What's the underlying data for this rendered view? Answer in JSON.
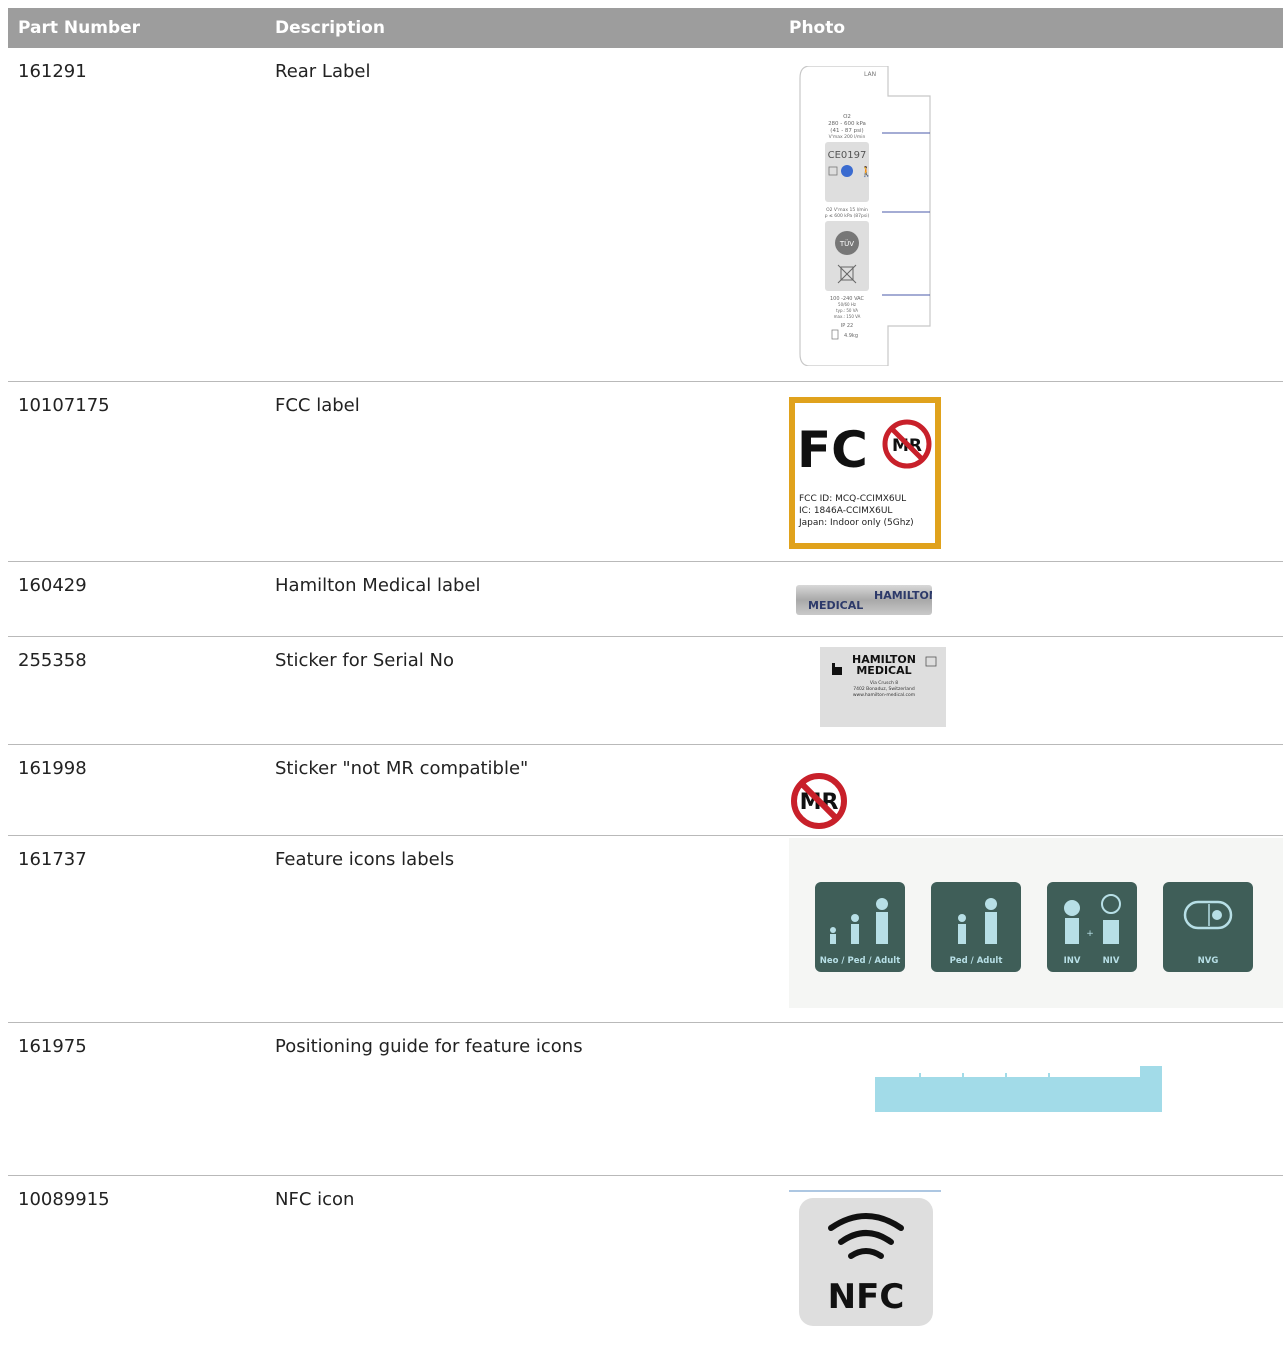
{
  "table": {
    "headers": {
      "part_number": "Part Number",
      "description": "Description",
      "photo": "Photo"
    },
    "rows": [
      {
        "part_number": "161291",
        "description": "Rear Label",
        "photo": {
          "top_text": "LAN",
          "lines": [
            "O2",
            "280 - 600 kPa",
            "(41 - 87 psi)",
            "V'max 200 l/min"
          ],
          "ce": "CE0197",
          "lines2": [
            "O2 V'max 15 l/min",
            "p ≤ 600 kPa (87psi)"
          ],
          "tuv": "TÜV",
          "lines3": [
            "100 -240 VAC",
            "50/60 Hz",
            "typ.: 50 VA",
            "max.: 150 VA",
            "IP 22",
            "4.9kg"
          ]
        }
      },
      {
        "part_number": "10107175",
        "description": "FCC label",
        "photo": {
          "fc": "FC",
          "mr": "MR",
          "lines": [
            "FCC ID: MCQ-CCIMX6UL",
            "IC: 1846A-CCIMX6UL",
            "Japan: Indoor only (5Ghz)"
          ]
        }
      },
      {
        "part_number": "160429",
        "description": "Hamilton Medical label",
        "photo": {
          "line1": "HAMILTON",
          "line2": "MEDICAL"
        }
      },
      {
        "part_number": "255358",
        "description": "Sticker for Serial No",
        "photo": {
          "line1": "HAMILTON",
          "line2": "MEDICAL",
          "address": [
            "Via Crusch 8",
            "7402 Bonaduz, Switzerland",
            "www.hamilton-medical.com"
          ]
        }
      },
      {
        "part_number": "161998",
        "description": "Sticker \"not MR compatible\"",
        "photo": {
          "mr": "MR"
        }
      },
      {
        "part_number": "161737",
        "description": "Feature icons labels",
        "photo": {
          "labels": [
            "Neo / Ped / Adult",
            "Ped / Adult",
            "INV",
            "NIV",
            "NVG"
          ]
        }
      },
      {
        "part_number": "161975",
        "description": "Positioning guide for feature icons",
        "photo": {}
      },
      {
        "part_number": "10089915",
        "description": "NFC icon",
        "photo": {
          "text": "NFC"
        }
      }
    ]
  },
  "colors": {
    "header_bg": "#9d9d9d",
    "fcc_border": "#e0a21c",
    "prohibition_red": "#c8202a",
    "feature_icon_bg": "#3f5e58",
    "feature_icon_figure": "#b7dfe6",
    "guide_blue": "#a2dbe8"
  }
}
